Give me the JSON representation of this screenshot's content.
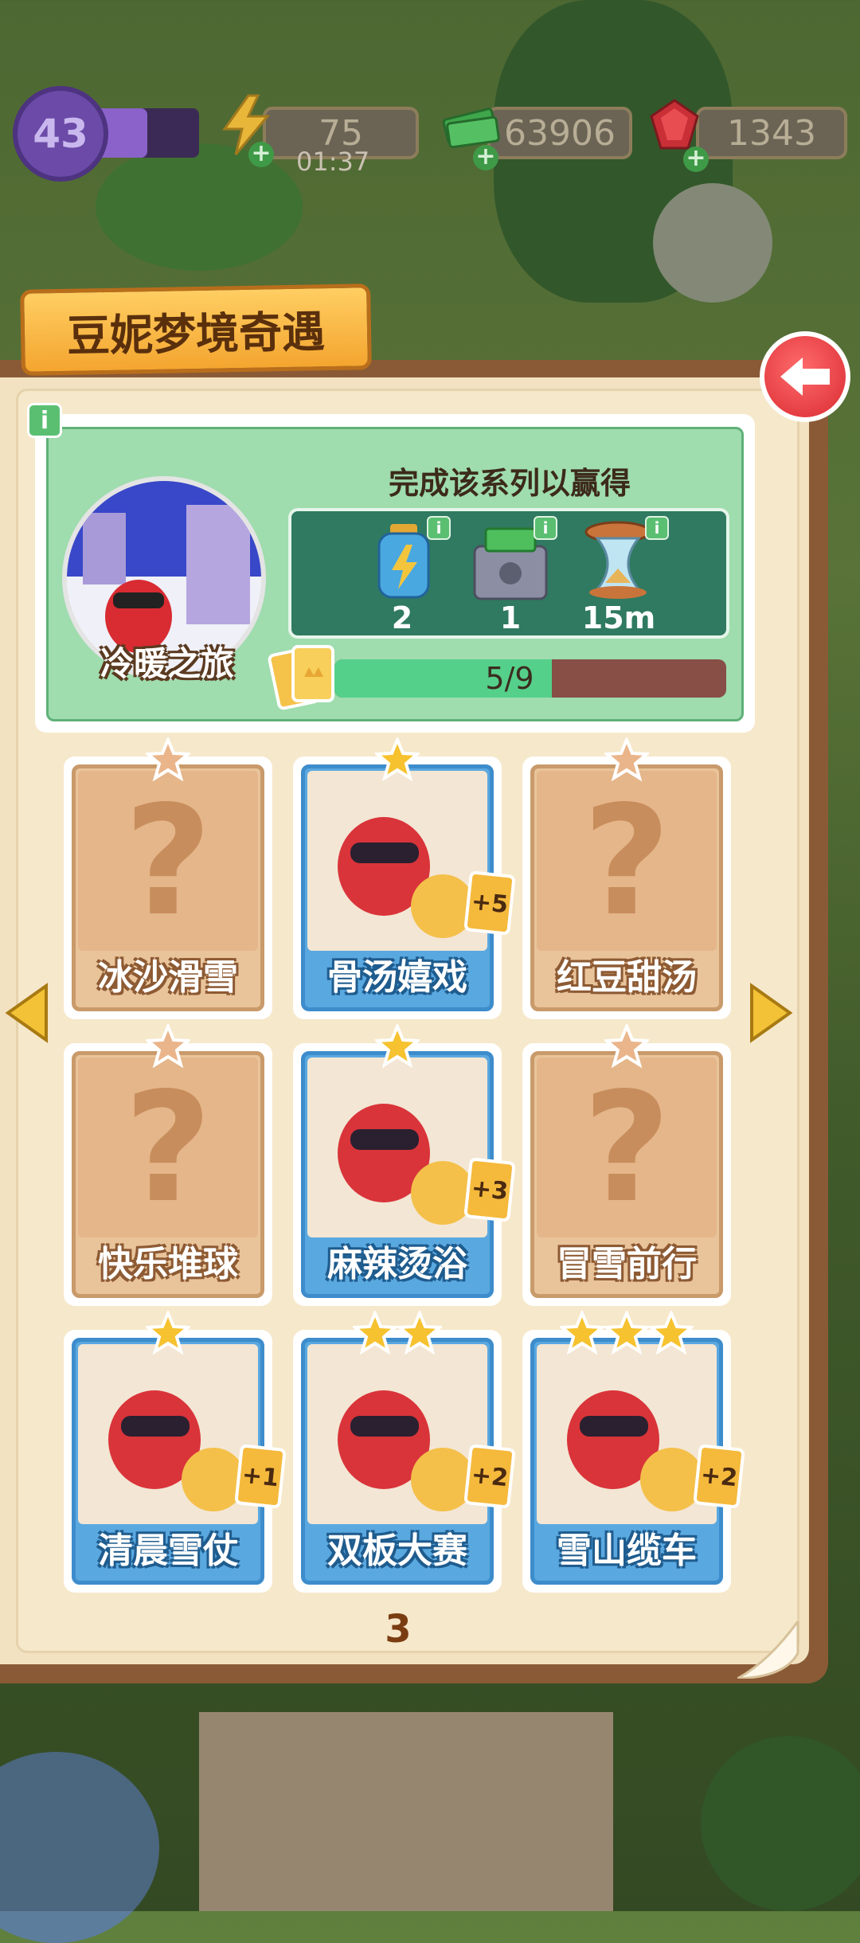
{
  "hud": {
    "level": "43",
    "xp_fraction": 0.5,
    "energy": "75",
    "energy_timer": "01:37",
    "cash": "63906",
    "gems": "1343",
    "icons": [
      "level-badge-icon",
      "lightning-icon",
      "cash-stack-icon",
      "ruby-icon"
    ]
  },
  "panel": {
    "title": "豆妮梦境奇遇",
    "back_icon": "back-arrow-icon"
  },
  "series": {
    "name": "冷暖之旅",
    "reward_heading": "完成该系列以赢得",
    "rewards": [
      {
        "icon": "energy-bottle-icon",
        "value": "2"
      },
      {
        "icon": "cash-safe-icon",
        "value": "1"
      },
      {
        "icon": "hourglass-icon",
        "value": "15m"
      }
    ],
    "progress_text": "5/9",
    "progress_fraction": 0.555
  },
  "cards": [
    {
      "name": "冰沙滑雪",
      "collected": false,
      "stars": 1,
      "dup": ""
    },
    {
      "name": "骨汤嬉戏",
      "collected": true,
      "stars": 1,
      "dup": "+5"
    },
    {
      "name": "红豆甜汤",
      "collected": false,
      "stars": 1,
      "dup": ""
    },
    {
      "name": "快乐堆球",
      "collected": false,
      "stars": 1,
      "dup": ""
    },
    {
      "name": "麻辣烫浴",
      "collected": true,
      "stars": 1,
      "dup": "+3"
    },
    {
      "name": "冒雪前行",
      "collected": false,
      "stars": 1,
      "dup": ""
    },
    {
      "name": "清晨雪仗",
      "collected": true,
      "stars": 1,
      "dup": "+1"
    },
    {
      "name": "双板大赛",
      "collected": true,
      "stars": 2,
      "dup": "+2"
    },
    {
      "name": "雪山缆车",
      "collected": true,
      "stars": 3,
      "dup": "+2"
    }
  ],
  "page_number": "3",
  "colors": {
    "accent_green": "#55d08a",
    "tab_orange": "#f4a52f",
    "card_blue": "#5aa8e0",
    "card_locked": "#e9c49a",
    "back_red": "#d92b32"
  }
}
